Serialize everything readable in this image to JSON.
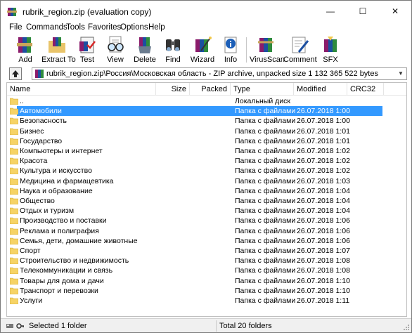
{
  "window": {
    "title": "rubrik_region.zip (evaluation copy)",
    "controls": {
      "minimize": "—",
      "maximize": "☐",
      "close": "✕"
    }
  },
  "menu": [
    "File",
    "Commands",
    "Tools",
    "Favorites",
    "Options",
    "Help"
  ],
  "toolbar": [
    {
      "label": "Add",
      "icon": "archive-books-icon"
    },
    {
      "label": "Extract To",
      "icon": "folder-extract-icon"
    },
    {
      "label": "Test",
      "icon": "checklist-icon"
    },
    {
      "label": "View",
      "icon": "glasses-icon"
    },
    {
      "label": "Delete",
      "icon": "trash-icon"
    },
    {
      "label": "Find",
      "icon": "binoculars-icon"
    },
    {
      "label": "Wizard",
      "icon": "wizard-wand-icon"
    },
    {
      "label": "Info",
      "icon": "info-icon"
    },
    {
      "label": "VirusScan",
      "icon": "virus-scan-icon"
    },
    {
      "label": "Comment",
      "icon": "comment-pen-icon"
    },
    {
      "label": "SFX",
      "icon": "sfx-books-icon"
    }
  ],
  "address": {
    "path": "rubrik_region.zip\\Россия\\Московская область - ZIP archive, unpacked size 1 132 365 522 bytes"
  },
  "columns": {
    "name": "Name",
    "size": "Size",
    "packed": "Packed",
    "type": "Type",
    "modified": "Modified",
    "crc": "CRC32"
  },
  "rows": [
    {
      "name": "..",
      "type": "Локальный диск",
      "modified": "",
      "selected": false
    },
    {
      "name": "Автомобили",
      "type": "Папка с файлами",
      "modified": "26.07.2018 1:00",
      "selected": true
    },
    {
      "name": "Безопасность",
      "type": "Папка с файлами",
      "modified": "26.07.2018 1:00",
      "selected": false
    },
    {
      "name": "Бизнес",
      "type": "Папка с файлами",
      "modified": "26.07.2018 1:01",
      "selected": false
    },
    {
      "name": "Государство",
      "type": "Папка с файлами",
      "modified": "26.07.2018 1:01",
      "selected": false
    },
    {
      "name": "Компьютеры и интернет",
      "type": "Папка с файлами",
      "modified": "26.07.2018 1:02",
      "selected": false
    },
    {
      "name": "Красота",
      "type": "Папка с файлами",
      "modified": "26.07.2018 1:02",
      "selected": false
    },
    {
      "name": "Культура и искусство",
      "type": "Папка с файлами",
      "modified": "26.07.2018 1:02",
      "selected": false
    },
    {
      "name": "Медицина и фармацевтика",
      "type": "Папка с файлами",
      "modified": "26.07.2018 1:03",
      "selected": false
    },
    {
      "name": "Наука и образование",
      "type": "Папка с файлами",
      "modified": "26.07.2018 1:04",
      "selected": false
    },
    {
      "name": "Общество",
      "type": "Папка с файлами",
      "modified": "26.07.2018 1:04",
      "selected": false
    },
    {
      "name": "Отдых и туризм",
      "type": "Папка с файлами",
      "modified": "26.07.2018 1:04",
      "selected": false
    },
    {
      "name": "Производство и поставки",
      "type": "Папка с файлами",
      "modified": "26.07.2018 1:06",
      "selected": false
    },
    {
      "name": "Реклама и полиграфия",
      "type": "Папка с файлами",
      "modified": "26.07.2018 1:06",
      "selected": false
    },
    {
      "name": "Семья, дети, домашние животные",
      "type": "Папка с файлами",
      "modified": "26.07.2018 1:06",
      "selected": false
    },
    {
      "name": "Спорт",
      "type": "Папка с файлами",
      "modified": "26.07.2018 1:07",
      "selected": false
    },
    {
      "name": "Строительство и недвижимость",
      "type": "Папка с файлами",
      "modified": "26.07.2018 1:08",
      "selected": false
    },
    {
      "name": "Телекоммуникации и связь",
      "type": "Папка с файлами",
      "modified": "26.07.2018 1:08",
      "selected": false
    },
    {
      "name": "Товары для дома и дачи",
      "type": "Папка с файлами",
      "modified": "26.07.2018 1:10",
      "selected": false
    },
    {
      "name": "Транспорт и перевозки",
      "type": "Папка с файлами",
      "modified": "26.07.2018 1:10",
      "selected": false
    },
    {
      "name": "Услуги",
      "type": "Папка с файлами",
      "modified": "26.07.2018 1:11",
      "selected": false
    }
  ],
  "status": {
    "left": "Selected 1 folder",
    "right": "Total 20 folders"
  },
  "colors": {
    "selection": "#3399ff",
    "folder": "#f6d365"
  }
}
